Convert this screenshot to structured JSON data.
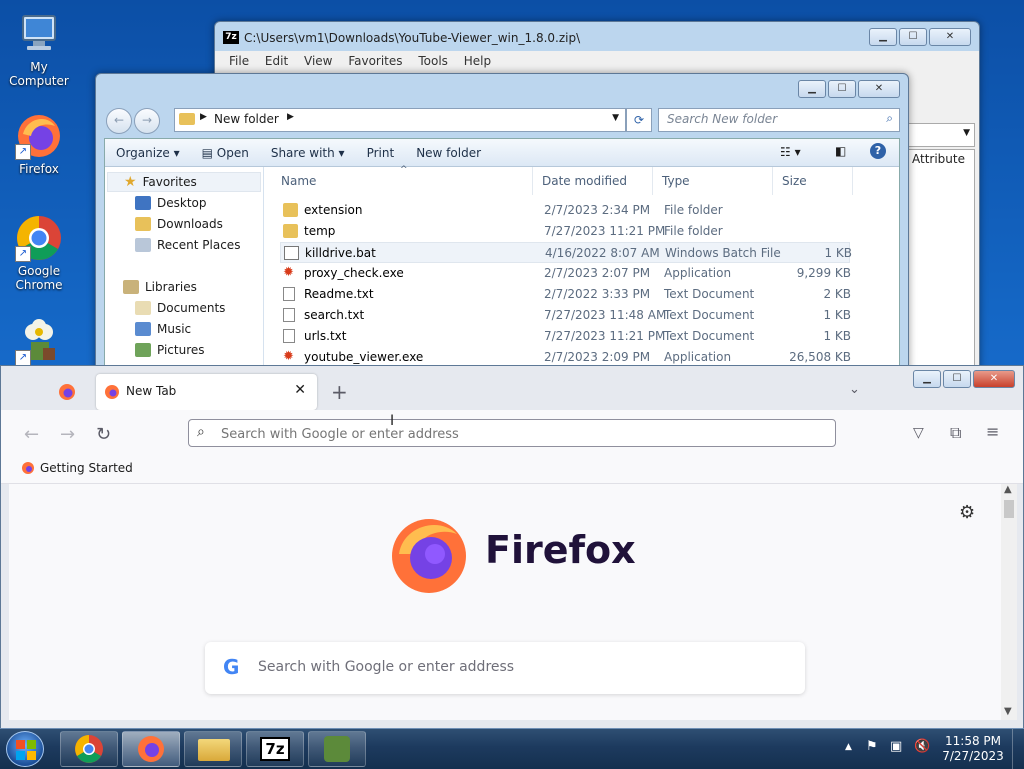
{
  "desktop": {
    "icons": [
      {
        "label": "My Computer"
      },
      {
        "label": "Firefox"
      },
      {
        "label": "Google Chrome"
      },
      {
        "label": ""
      }
    ]
  },
  "zip_window": {
    "title": "C:\\Users\\vm1\\Downloads\\YouTube-Viewer_win_1.8.0.zip\\",
    "app_icon": "7z",
    "menu": [
      "File",
      "Edit",
      "View",
      "Favorites",
      "Tools",
      "Help"
    ],
    "column_partial": "Attribute"
  },
  "explorer": {
    "breadcrumb": "New folder",
    "search_placeholder": "Search New folder",
    "toolbar": {
      "organize": "Organize",
      "open": "Open",
      "share_with": "Share with",
      "print": "Print",
      "new_folder": "New folder"
    },
    "nav": {
      "favorites": "Favorites",
      "desktop": "Desktop",
      "downloads": "Downloads",
      "recent": "Recent Places",
      "libraries": "Libraries",
      "documents": "Documents",
      "music": "Music",
      "pictures": "Pictures"
    },
    "columns": {
      "name": "Name",
      "date": "Date modified",
      "type": "Type",
      "size": "Size"
    },
    "files": [
      {
        "name": "extension",
        "date": "2/7/2023 2:34 PM",
        "type": "File folder",
        "size": ""
      },
      {
        "name": "temp",
        "date": "7/27/2023 11:21 PM",
        "type": "File folder",
        "size": ""
      },
      {
        "name": "killdrive.bat",
        "date": "4/16/2022 8:07 AM",
        "type": "Windows Batch File",
        "size": "1 KB"
      },
      {
        "name": "proxy_check.exe",
        "date": "2/7/2023 2:07 PM",
        "type": "Application",
        "size": "9,299 KB"
      },
      {
        "name": "Readme.txt",
        "date": "2/7/2022 3:33 PM",
        "type": "Text Document",
        "size": "2 KB"
      },
      {
        "name": "search.txt",
        "date": "7/27/2023 11:48 AM",
        "type": "Text Document",
        "size": "1 KB"
      },
      {
        "name": "urls.txt",
        "date": "7/27/2023 11:21 PM",
        "type": "Text Document",
        "size": "1 KB"
      },
      {
        "name": "youtube_viewer.exe",
        "date": "2/7/2023 2:09 PM",
        "type": "Application",
        "size": "26,508 KB"
      }
    ]
  },
  "firefox": {
    "tab_title": "New Tab",
    "urlbar_placeholder": "Search with Google or enter address",
    "bookmark": "Getting Started",
    "brand": "Firefox",
    "page_search_placeholder": "Search with Google or enter address"
  },
  "taskbar": {
    "time": "11:58 PM",
    "date": "7/27/2023",
    "sevenzip_label": "7z"
  },
  "colors": {
    "firefox_orange": "#ff7139",
    "firefox_purple": "#7542e5",
    "explorer_selection": "#eef3f9",
    "taskbar": "#1d3a5e"
  }
}
